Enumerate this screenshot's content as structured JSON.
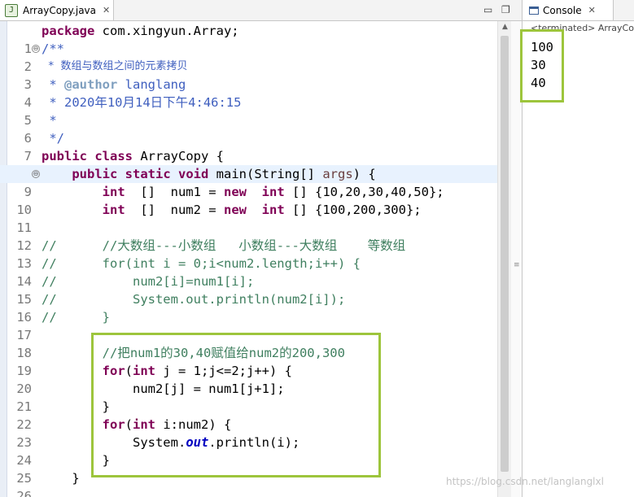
{
  "editor": {
    "tab_label": "ArrayCopy.java",
    "tab_close": "✕",
    "minimize": "▭",
    "maximize": "❐"
  },
  "code_lines": [
    {
      "n": "1",
      "fold": ""
    },
    {
      "n": "2",
      "fold": "⊖"
    },
    {
      "n": "3",
      "fold": ""
    },
    {
      "n": "4",
      "fold": ""
    },
    {
      "n": "5",
      "fold": ""
    },
    {
      "n": "6",
      "fold": ""
    },
    {
      "n": "7",
      "fold": ""
    },
    {
      "n": "8",
      "fold": ""
    },
    {
      "n": "9",
      "fold": "⊖"
    },
    {
      "n": "10",
      "fold": ""
    },
    {
      "n": "11",
      "fold": ""
    },
    {
      "n": "12",
      "fold": ""
    },
    {
      "n": "13",
      "fold": ""
    },
    {
      "n": "14",
      "fold": ""
    },
    {
      "n": "15",
      "fold": ""
    },
    {
      "n": "16",
      "fold": ""
    },
    {
      "n": "17",
      "fold": ""
    },
    {
      "n": "18",
      "fold": ""
    },
    {
      "n": "19",
      "fold": ""
    },
    {
      "n": "20",
      "fold": ""
    },
    {
      "n": "21",
      "fold": ""
    },
    {
      "n": "22",
      "fold": ""
    },
    {
      "n": "23",
      "fold": ""
    },
    {
      "n": "24",
      "fold": ""
    },
    {
      "n": "25",
      "fold": ""
    },
    {
      "n": "26",
      "fold": ""
    }
  ],
  "code": {
    "l1": {
      "kw": "package",
      "rest": " com.xingyun.Array;"
    },
    "l2": {
      "jd": "/**"
    },
    "l3": {
      "jd": " * 数组与数组之间的元素拷贝"
    },
    "l4": {
      "jd_pre": " * ",
      "tag": "@author",
      "jd_post": " langlang"
    },
    "l5": {
      "jd": " * 2020年10月14日下午4:46:15"
    },
    "l6": {
      "jd": " *"
    },
    "l7": {
      "jd": " */"
    },
    "l8": {
      "kw1": "public",
      "sp1": " ",
      "kw2": "class",
      "rest": " ArrayCopy {"
    },
    "l9": {
      "ind": "    ",
      "kw1": "public",
      "kw2": "static",
      "kw3": "void",
      "pre": " main(String[] ",
      "param": "args",
      "post": ") {"
    },
    "l10": {
      "ind": "        ",
      "kw1": "int",
      "mid1": "  []  num1 = ",
      "kw2": "new",
      "mid2": "  ",
      "kw3": "int",
      "post": " [] {10,20,30,40,50};"
    },
    "l11": {
      "ind": "        ",
      "kw1": "int",
      "mid1": "  []  num2 = ",
      "kw2": "new",
      "mid2": "  ",
      "kw3": "int",
      "post": " [] {100,200,300};"
    },
    "l13": {
      "cm": "//      //大数组---小数组   小数组---大数组    等数组"
    },
    "l14": {
      "cm": "//      for(int i = 0;i<num2.length;i++) {"
    },
    "l15": {
      "cm": "//          num2[i]=num1[i];"
    },
    "l16": {
      "cm": "//          System.out.println(num2[i]);"
    },
    "l17": {
      "cm": "//      }"
    },
    "l19": {
      "ind": "        ",
      "cm": "//把num1的30,40赋值给num2的200,300"
    },
    "l20": {
      "ind": "        ",
      "kw1": "for",
      "pre": "(",
      "kw2": "int",
      "post": " j = 1;j<=2;j++) {"
    },
    "l21": {
      "ind": "            ",
      "rest": "num2[j] = num1[j+1];"
    },
    "l22": {
      "ind": "        ",
      "rest": "}"
    },
    "l23": {
      "ind": "        ",
      "kw1": "for",
      "pre": "(",
      "kw2": "int",
      "post": " i:num2) {"
    },
    "l24": {
      "ind": "            ",
      "pre": "System.",
      "fld": "out",
      "post": ".println(i);"
    },
    "l25": {
      "ind": "        ",
      "rest": "}"
    },
    "l26": {
      "ind": "    ",
      "rest": "}"
    }
  },
  "console": {
    "tab_label": "Console",
    "tab_close": "✕",
    "status": "<terminated> ArrayCopy",
    "output": [
      "100",
      "30",
      "40"
    ]
  },
  "watermark": "https://blog.csdn.net/langlanglxl",
  "colors": {
    "highlight_box": "#9dc53c",
    "keyword": "#7f0055",
    "comment": "#3f7f5f",
    "javadoc": "#3f5fbf"
  }
}
